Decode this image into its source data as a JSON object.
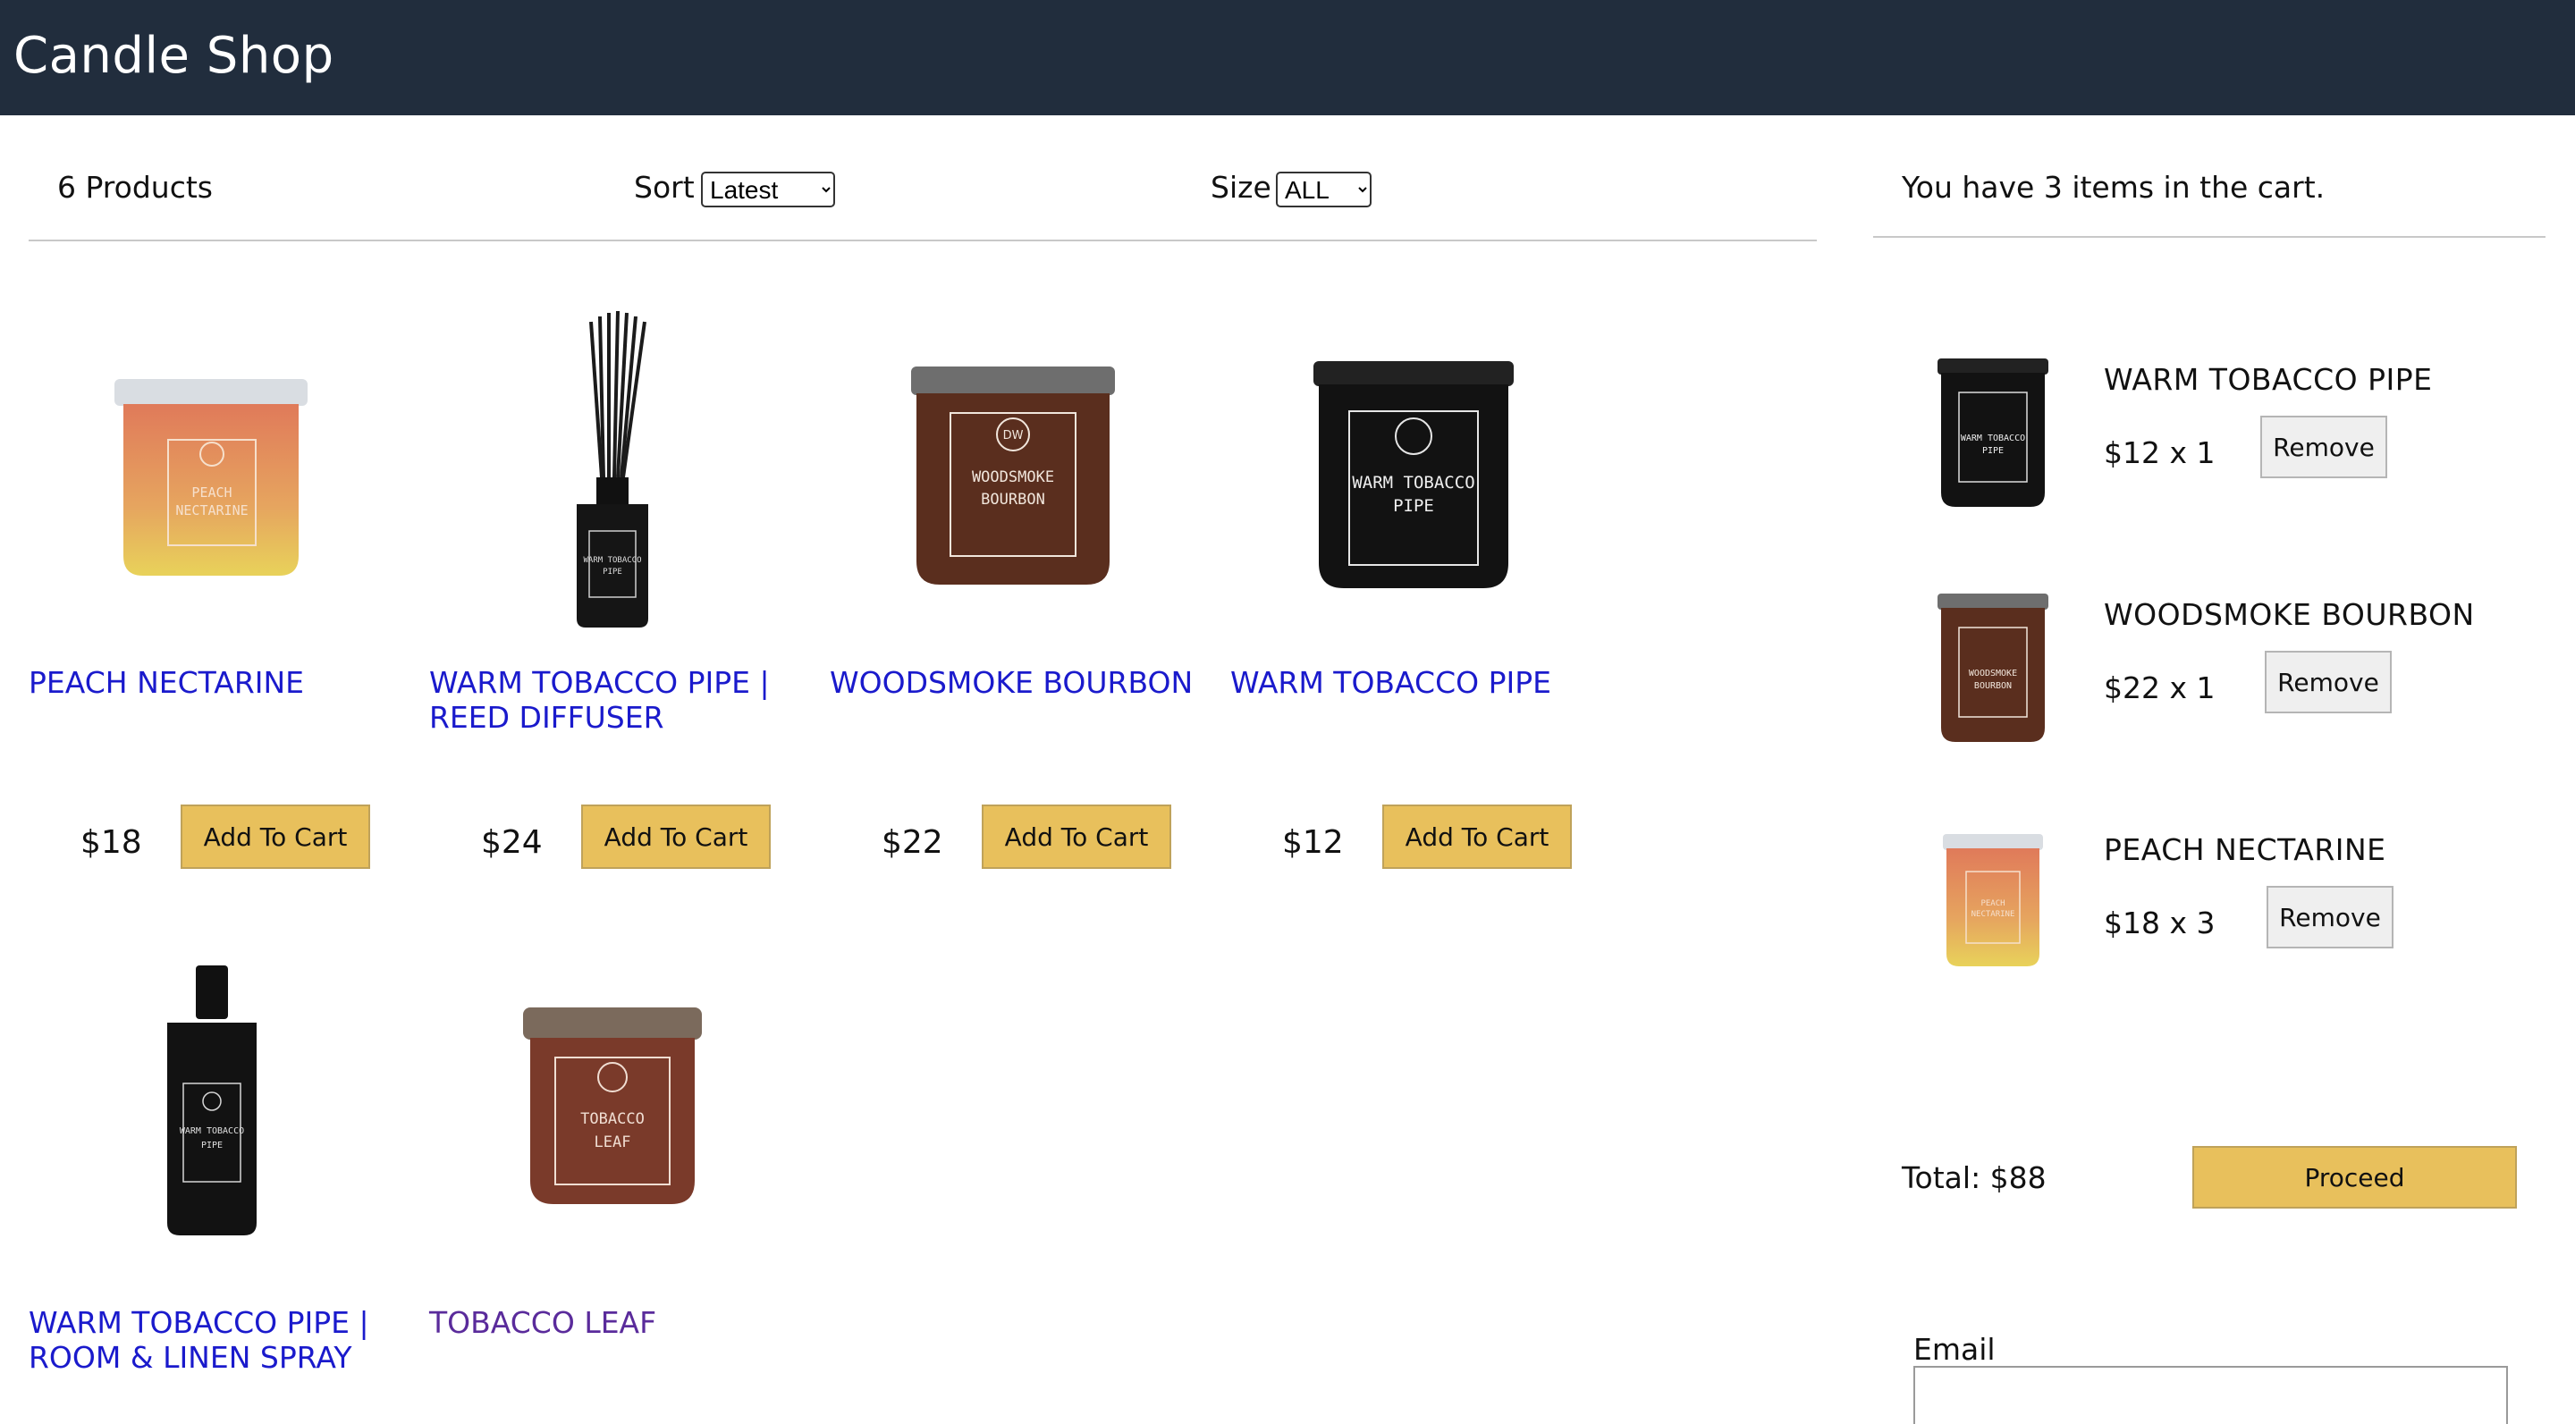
{
  "header": {
    "title": "Candle Shop"
  },
  "filter": {
    "count": "6 Products",
    "sort_label": "Sort",
    "sort_selected": "Latest",
    "size_label": "Size",
    "size_selected": "ALL"
  },
  "products": [
    {
      "name": "PEACH NECTARINE",
      "price": "$18",
      "add_label": "Add To Cart",
      "image_icon": "peach-candle-image"
    },
    {
      "name": "WARM TOBACCO PIPE | REED DIFFUSER",
      "price": "$24",
      "add_label": "Add To Cart",
      "image_icon": "reed-diffuser-image"
    },
    {
      "name": "WOODSMOKE BOURBON",
      "price": "$22",
      "add_label": "Add To Cart",
      "image_icon": "bourbon-candle-image"
    },
    {
      "name": "WARM TOBACCO PIPE",
      "price": "$12",
      "add_label": "Add To Cart",
      "image_icon": "black-candle-image"
    },
    {
      "name": "WARM TOBACCO PIPE | ROOM & LINEN SPRAY",
      "image_icon": "room-spray-image"
    },
    {
      "name": "TOBACCO LEAF",
      "image_icon": "tobacco-leaf-candle-image"
    }
  ],
  "cart": {
    "message": "You have 3 items in the cart.",
    "items": [
      {
        "name": "WARM TOBACCO PIPE",
        "price_qty": "$12 x 1",
        "remove_label": "Remove"
      },
      {
        "name": "WOODSMOKE BOURBON",
        "price_qty": "$22 x 1",
        "remove_label": "Remove"
      },
      {
        "name": "PEACH NECTARINE",
        "price_qty": "$18 x 3",
        "remove_label": "Remove"
      }
    ],
    "total": "Total: $88",
    "proceed_label": "Proceed",
    "email_label": "Email",
    "email_value": ""
  },
  "colors": {
    "header_bg": "#212d3d",
    "accent_button": "#e8c05c",
    "link": "#1a1acc",
    "visited_link": "#5a2b9b"
  }
}
